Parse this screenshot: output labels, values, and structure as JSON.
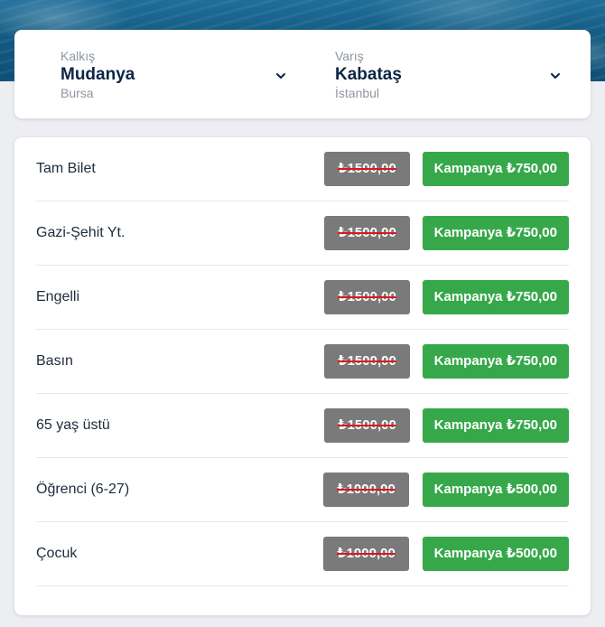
{
  "route": {
    "from": {
      "label": "Kalkış",
      "city": "Mudanya",
      "region": "Bursa"
    },
    "to": {
      "label": "Varış",
      "city": "Kabataş",
      "region": "İstanbul"
    }
  },
  "fares": [
    {
      "name": "Tam Bilet",
      "old_price": "₺1500,00",
      "campaign": "Kampanya ₺750,00"
    },
    {
      "name": "Gazi-Şehit Yt.",
      "old_price": "₺1500,00",
      "campaign": "Kampanya ₺750,00"
    },
    {
      "name": "Engelli",
      "old_price": "₺1500,00",
      "campaign": "Kampanya ₺750,00"
    },
    {
      "name": "Basın",
      "old_price": "₺1500,00",
      "campaign": "Kampanya ₺750,00"
    },
    {
      "name": "65 yaş üstü",
      "old_price": "₺1500,00",
      "campaign": "Kampanya ₺750,00"
    },
    {
      "name": "Öğrenci (6-27)",
      "old_price": "₺1000,00",
      "campaign": "Kampanya ₺500,00"
    },
    {
      "name": "Çocuk",
      "old_price": "₺1000,00",
      "campaign": "Kampanya ₺500,00"
    }
  ],
  "colors": {
    "campaign_green": "#37a84a",
    "old_price_gray": "#7a7a7a",
    "strike_red": "#e0141e",
    "city_navy": "#0d2545"
  },
  "icons": {
    "dropdown": "chevron-down-icon"
  }
}
